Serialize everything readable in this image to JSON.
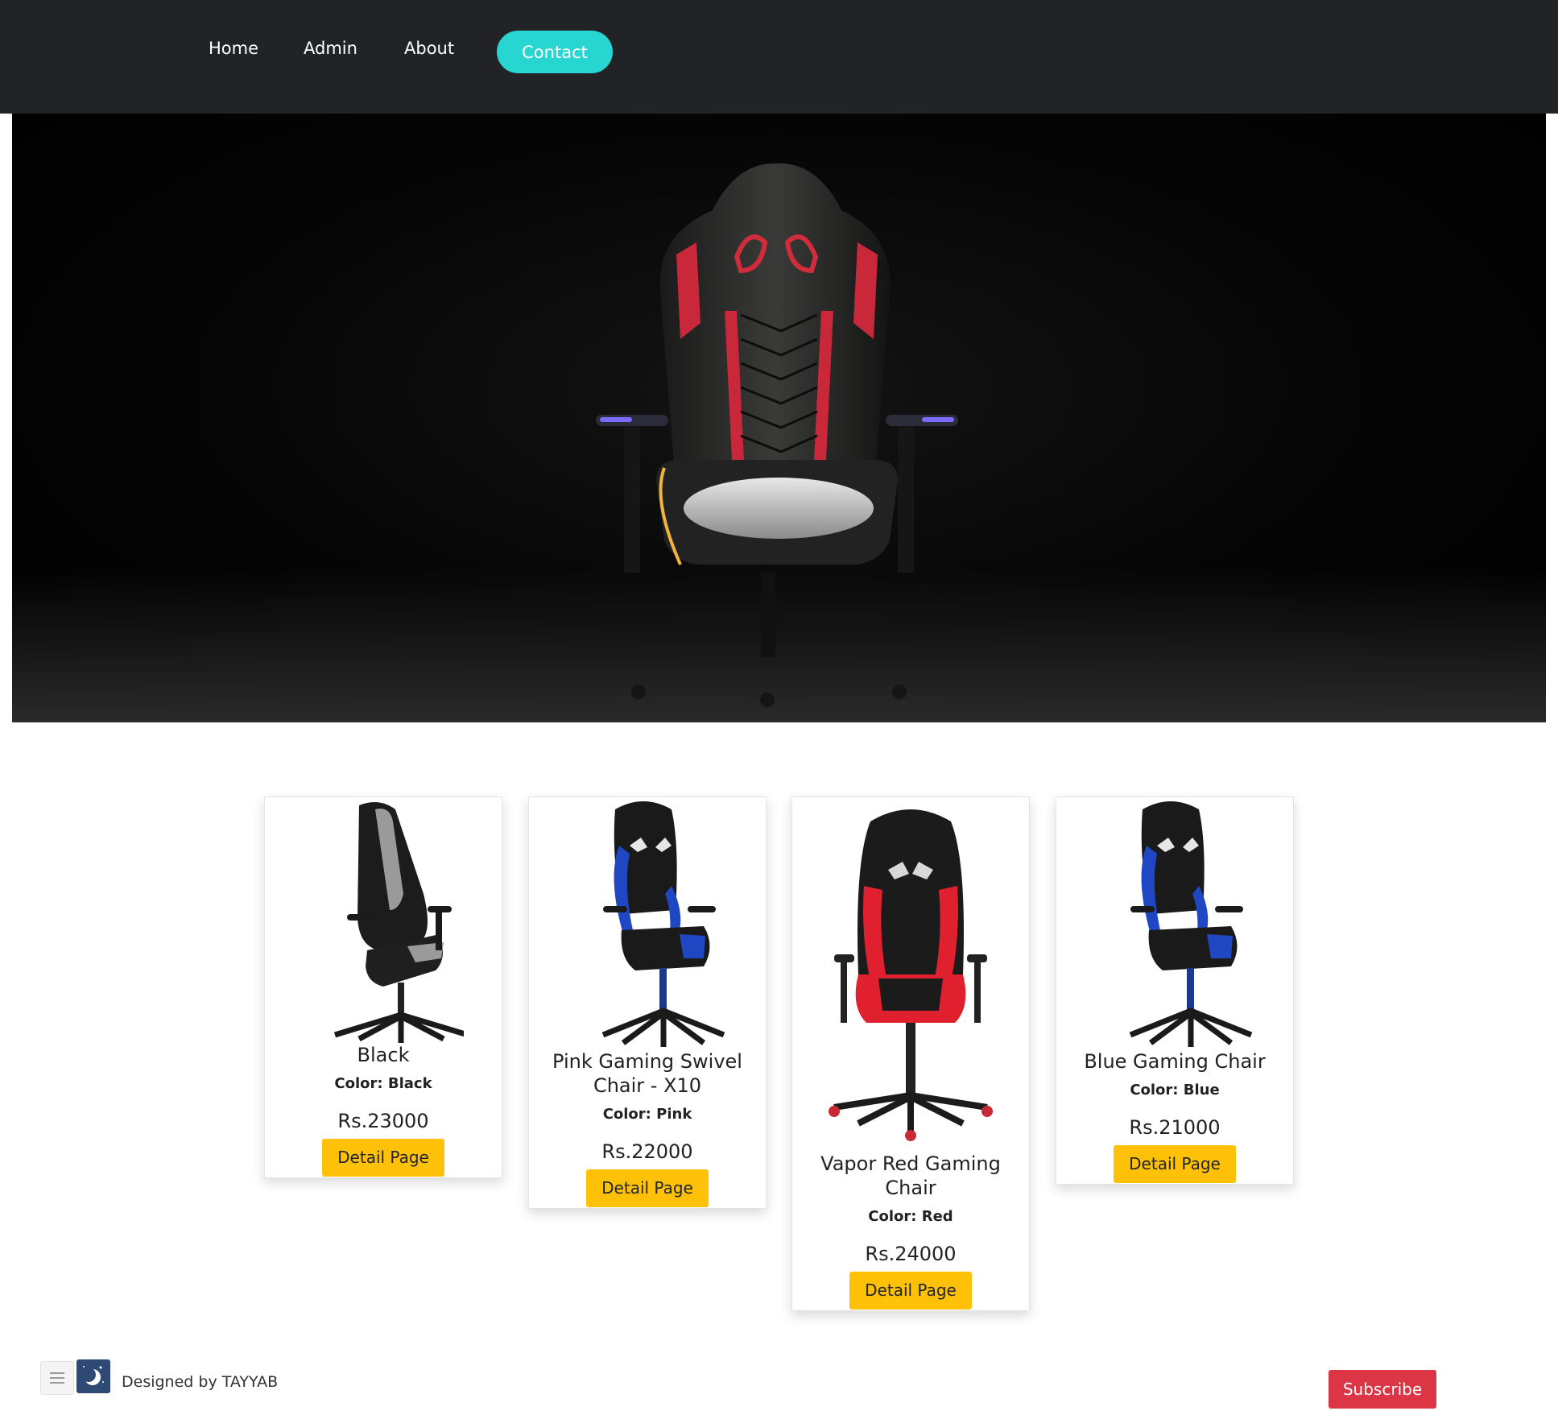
{
  "nav": {
    "home": "Home",
    "admin": "Admin",
    "about": "About",
    "contact": "Contact"
  },
  "hero": {
    "image": "gaming-chair-hero"
  },
  "products": [
    {
      "name": "Black",
      "color_label": "Color: Black",
      "price": "Rs.23000",
      "button": "Detail Page",
      "chair_color": "#9a9a9a"
    },
    {
      "name": "Pink Gaming Swivel Chair - X10",
      "color_label": "Color: Pink",
      "price": "Rs.22000",
      "button": "Detail Page",
      "chair_color": "#1f47c4"
    },
    {
      "name": "Vapor Red Gaming Chair",
      "color_label": "Color: Red",
      "price": "Rs.24000",
      "button": "Detail Page",
      "chair_color": "#e0202e"
    },
    {
      "name": "Blue Gaming Chair",
      "color_label": "Color: Blue",
      "price": "Rs.21000",
      "button": "Detail Page",
      "chair_color": "#1f47c4"
    }
  ],
  "footer": {
    "credit": "Designed by TAYYAB",
    "subscribe": "Subscribe"
  },
  "colors": {
    "navbar": "#222327",
    "contact": "#27d6d0",
    "detail_button": "#ffc107",
    "subscribe": "#dc3545"
  }
}
